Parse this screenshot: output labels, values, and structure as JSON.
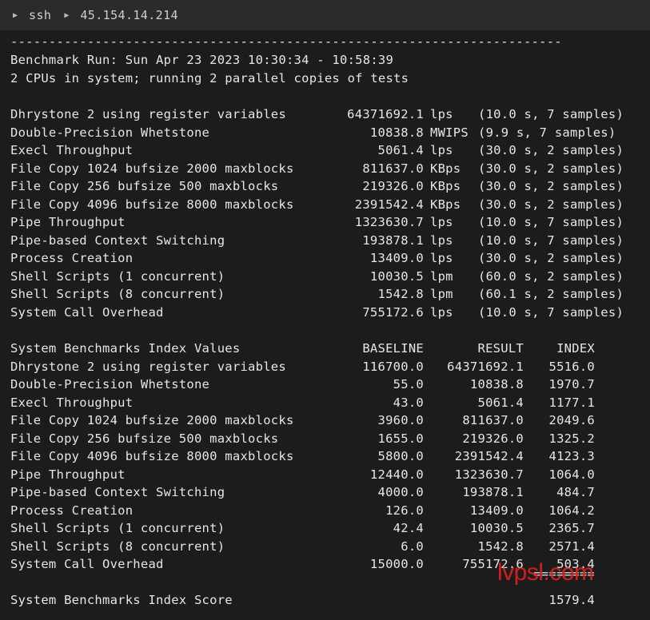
{
  "tabbar": {
    "crumbs": [
      "ssh",
      "45.154.14.214"
    ]
  },
  "terminal": {
    "separator": "------------------------------------------------------------------------",
    "run_line": "Benchmark Run: Sun Apr 23 2023 10:30:34 - 10:58:39",
    "cpu_line": "2 CPUs in system; running 2 parallel copies of tests",
    "results": [
      {
        "name": "Dhrystone 2 using register variables",
        "value": "64371692.1",
        "unit": "lps",
        "detail": "(10.0 s, 7 samples)"
      },
      {
        "name": "Double-Precision Whetstone",
        "value": "10838.8",
        "unit": "MWIPS",
        "detail": "(9.9 s, 7 samples)"
      },
      {
        "name": "Execl Throughput",
        "value": "5061.4",
        "unit": "lps",
        "detail": "(30.0 s, 2 samples)"
      },
      {
        "name": "File Copy 1024 bufsize 2000 maxblocks",
        "value": "811637.0",
        "unit": "KBps",
        "detail": "(30.0 s, 2 samples)"
      },
      {
        "name": "File Copy 256 bufsize 500 maxblocks",
        "value": "219326.0",
        "unit": "KBps",
        "detail": "(30.0 s, 2 samples)"
      },
      {
        "name": "File Copy 4096 bufsize 8000 maxblocks",
        "value": "2391542.4",
        "unit": "KBps",
        "detail": "(30.0 s, 2 samples)"
      },
      {
        "name": "Pipe Throughput",
        "value": "1323630.7",
        "unit": "lps",
        "detail": "(10.0 s, 7 samples)"
      },
      {
        "name": "Pipe-based Context Switching",
        "value": "193878.1",
        "unit": "lps",
        "detail": "(10.0 s, 7 samples)"
      },
      {
        "name": "Process Creation",
        "value": "13409.0",
        "unit": "lps",
        "detail": "(30.0 s, 2 samples)"
      },
      {
        "name": "Shell Scripts (1 concurrent)",
        "value": "10030.5",
        "unit": "lpm",
        "detail": "(60.0 s, 2 samples)"
      },
      {
        "name": "Shell Scripts (8 concurrent)",
        "value": "1542.8",
        "unit": "lpm",
        "detail": "(60.1 s, 2 samples)"
      },
      {
        "name": "System Call Overhead",
        "value": "755172.6",
        "unit": "lps",
        "detail": "(10.0 s, 7 samples)"
      }
    ],
    "index_header": {
      "title": "System Benchmarks Index Values",
      "baseline": "BASELINE",
      "result": "RESULT",
      "index": "INDEX"
    },
    "index_rows": [
      {
        "name": "Dhrystone 2 using register variables",
        "baseline": "116700.0",
        "result": "64371692.1",
        "index": "5516.0"
      },
      {
        "name": "Double-Precision Whetstone",
        "baseline": "55.0",
        "result": "10838.8",
        "index": "1970.7"
      },
      {
        "name": "Execl Throughput",
        "baseline": "43.0",
        "result": "5061.4",
        "index": "1177.1"
      },
      {
        "name": "File Copy 1024 bufsize 2000 maxblocks",
        "baseline": "3960.0",
        "result": "811637.0",
        "index": "2049.6"
      },
      {
        "name": "File Copy 256 bufsize 500 maxblocks",
        "baseline": "1655.0",
        "result": "219326.0",
        "index": "1325.2"
      },
      {
        "name": "File Copy 4096 bufsize 8000 maxblocks",
        "baseline": "5800.0",
        "result": "2391542.4",
        "index": "4123.3"
      },
      {
        "name": "Pipe Throughput",
        "baseline": "12440.0",
        "result": "1323630.7",
        "index": "1064.0"
      },
      {
        "name": "Pipe-based Context Switching",
        "baseline": "4000.0",
        "result": "193878.1",
        "index": "484.7"
      },
      {
        "name": "Process Creation",
        "baseline": "126.0",
        "result": "13409.0",
        "index": "1064.2"
      },
      {
        "name": "Shell Scripts (1 concurrent)",
        "baseline": "42.4",
        "result": "10030.5",
        "index": "2365.7"
      },
      {
        "name": "Shell Scripts (8 concurrent)",
        "baseline": "6.0",
        "result": "1542.8",
        "index": "2571.4"
      },
      {
        "name": "System Call Overhead",
        "baseline": "15000.0",
        "result": "755172.6",
        "index": "503.4"
      }
    ],
    "index_rule": "========",
    "score_label": "System Benchmarks Index Score",
    "score_value": "1579.4"
  },
  "watermark": "lvpsl.com"
}
